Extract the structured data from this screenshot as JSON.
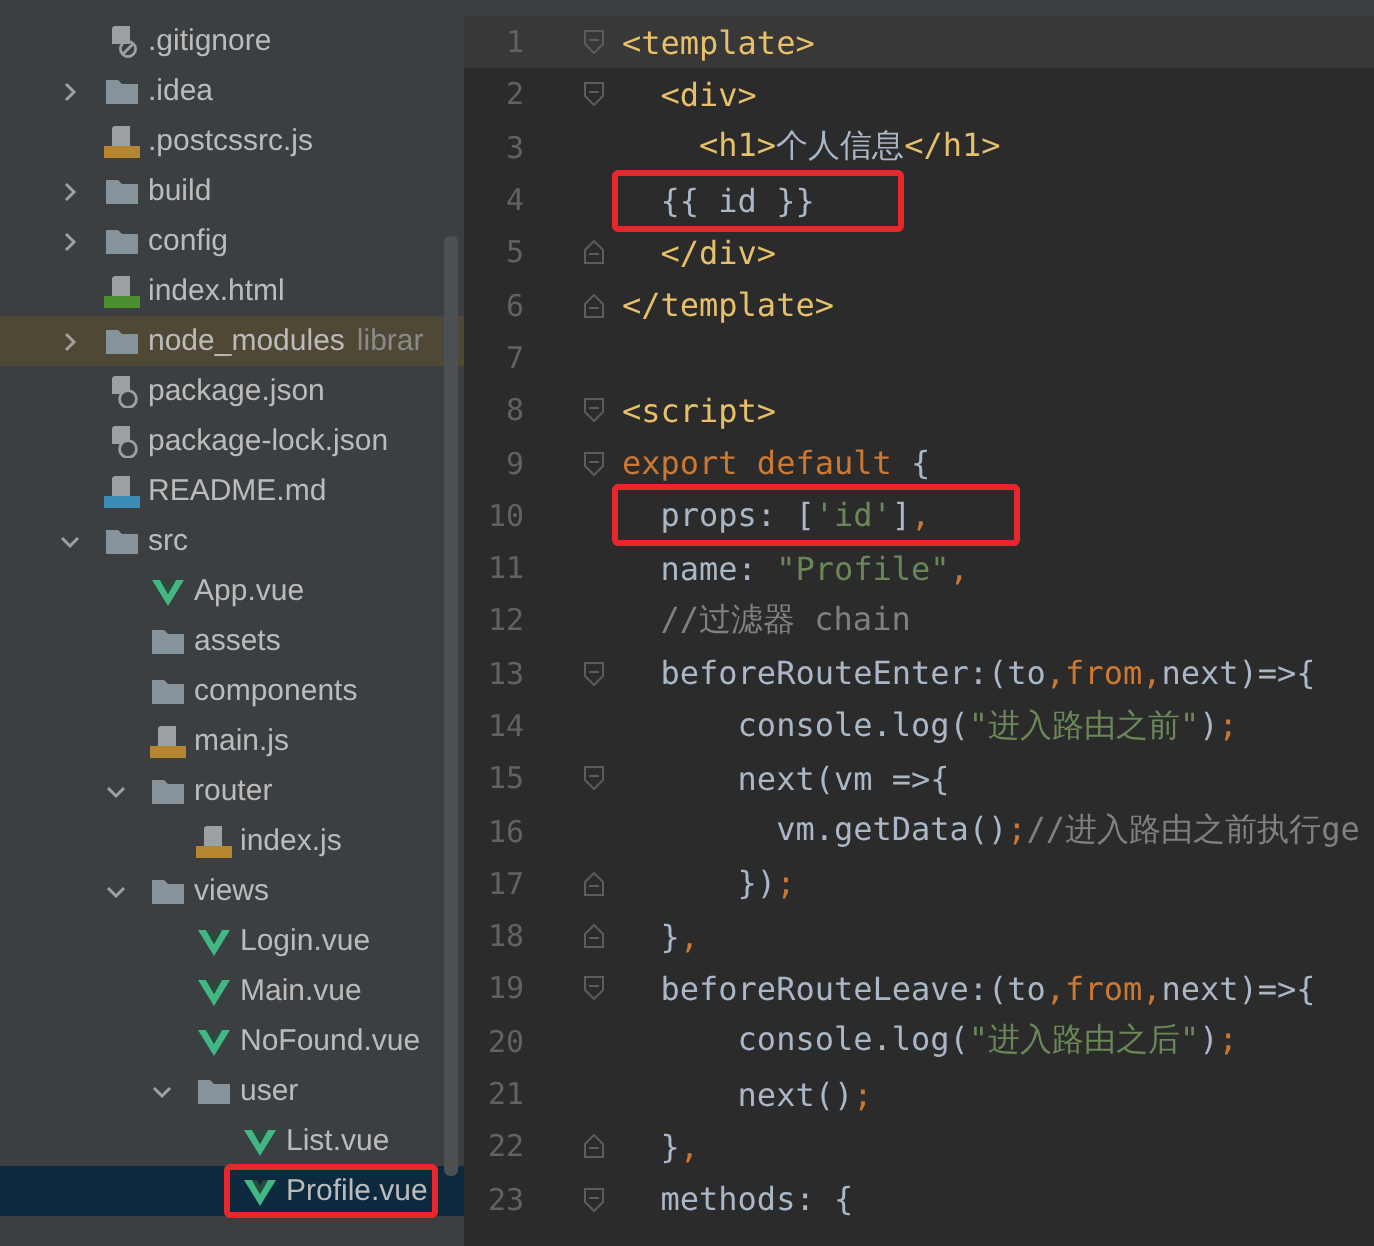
{
  "project_tree": {
    "items": [
      {
        "name": ".gitignore",
        "kind": "gitignore"
      },
      {
        "name": ".idea",
        "kind": "folder",
        "expanded": false
      },
      {
        "name": ".postcssrc.js",
        "kind": "js"
      },
      {
        "name": "build",
        "kind": "folder",
        "expanded": false
      },
      {
        "name": "config",
        "kind": "folder",
        "expanded": false
      },
      {
        "name": "index.html",
        "kind": "html"
      },
      {
        "name": "node_modules",
        "kind": "folder",
        "expanded": false,
        "suffix": "librar",
        "highlighted": true
      },
      {
        "name": "package.json",
        "kind": "json"
      },
      {
        "name": "package-lock.json",
        "kind": "json"
      },
      {
        "name": "README.md",
        "kind": "md"
      },
      {
        "name": "src",
        "kind": "folder",
        "expanded": true,
        "children": [
          {
            "name": "App.vue",
            "kind": "vue"
          },
          {
            "name": "assets",
            "kind": "folder"
          },
          {
            "name": "components",
            "kind": "folder"
          },
          {
            "name": "main.js",
            "kind": "js"
          },
          {
            "name": "router",
            "kind": "folder",
            "expanded": true,
            "children": [
              {
                "name": "index.js",
                "kind": "js"
              }
            ]
          },
          {
            "name": "views",
            "kind": "folder",
            "expanded": true,
            "children": [
              {
                "name": "Login.vue",
                "kind": "vue"
              },
              {
                "name": "Main.vue",
                "kind": "vue"
              },
              {
                "name": "NoFound.vue",
                "kind": "vue"
              },
              {
                "name": "user",
                "kind": "folder",
                "expanded": true,
                "children": [
                  {
                    "name": "List.vue",
                    "kind": "vue",
                    "selected": false
                  },
                  {
                    "name": "Profile.vue",
                    "kind": "vue",
                    "selected": true,
                    "boxed": true
                  }
                ]
              }
            ]
          }
        ]
      }
    ]
  },
  "editor": {
    "lines": [
      {
        "number": "1",
        "fold_start": true,
        "current": true,
        "tokens": [
          {
            "kind": "tag",
            "text": "<template>"
          }
        ]
      },
      {
        "number": "2",
        "fold_start": true,
        "tokens": [
          {
            "kind": "tag",
            "text": "  <div>"
          }
        ]
      },
      {
        "number": "3",
        "tokens": [
          {
            "kind": "tag",
            "text": "    <h1>"
          },
          {
            "kind": "plain",
            "text": "个人信息"
          },
          {
            "kind": "tag",
            "text": "</h1>"
          }
        ]
      },
      {
        "number": "4",
        "boxed": true,
        "tokens": [
          {
            "kind": "plain",
            "text": "  {{ id }}"
          }
        ]
      },
      {
        "number": "5",
        "fold_end": true,
        "tokens": [
          {
            "kind": "tag",
            "text": "  </div>"
          }
        ]
      },
      {
        "number": "6",
        "fold_end": true,
        "tokens": [
          {
            "kind": "tag",
            "text": "</template>"
          }
        ]
      },
      {
        "number": "7"
      },
      {
        "number": "8",
        "fold_start": true,
        "tokens": [
          {
            "kind": "tag",
            "text": "<script>"
          }
        ]
      },
      {
        "number": "9",
        "fold_start": true,
        "tokens": [
          {
            "kind": "keyword",
            "text": "export default"
          },
          {
            "kind": "plain",
            "text": " {"
          }
        ]
      },
      {
        "number": "10",
        "boxed": true,
        "tokens": [
          {
            "kind": "plain",
            "text": "  props: ["
          },
          {
            "kind": "string",
            "text": "'id'"
          },
          {
            "kind": "plain",
            "text": "]"
          },
          {
            "kind": "keyword",
            "text": ","
          }
        ]
      },
      {
        "number": "11",
        "tokens": [
          {
            "kind": "plain",
            "text": "  name: "
          },
          {
            "kind": "string",
            "text": "\"Profile\""
          },
          {
            "kind": "keyword",
            "text": ","
          }
        ]
      },
      {
        "number": "12",
        "tokens": [
          {
            "kind": "comment",
            "text": "  //过滤器 chain"
          }
        ]
      },
      {
        "number": "13",
        "fold_start": true,
        "tokens": [
          {
            "kind": "plain",
            "text": "  beforeRouteEnter:(to"
          },
          {
            "kind": "keyword",
            "text": ",from,"
          },
          {
            "kind": "plain",
            "text": "next)=>{"
          }
        ]
      },
      {
        "number": "14",
        "tokens": [
          {
            "kind": "plain",
            "text": "      console.log("
          },
          {
            "kind": "string",
            "text": "\"进入路由之前\""
          },
          {
            "kind": "plain",
            "text": ")"
          },
          {
            "kind": "keyword",
            "text": ";"
          }
        ]
      },
      {
        "number": "15",
        "fold_start": true,
        "tokens": [
          {
            "kind": "plain",
            "text": "      next(vm =>{"
          }
        ]
      },
      {
        "number": "16",
        "tokens": [
          {
            "kind": "plain",
            "text": "        vm.getData()"
          },
          {
            "kind": "keyword",
            "text": ";"
          },
          {
            "kind": "comment",
            "text": "//进入路由之前执行ge"
          }
        ]
      },
      {
        "number": "17",
        "fold_end": true,
        "tokens": [
          {
            "kind": "plain",
            "text": "      })"
          },
          {
            "kind": "keyword",
            "text": ";"
          }
        ]
      },
      {
        "number": "18",
        "fold_end": true,
        "tokens": [
          {
            "kind": "plain",
            "text": "  }"
          },
          {
            "kind": "keyword",
            "text": ","
          }
        ]
      },
      {
        "number": "19",
        "fold_start": true,
        "tokens": [
          {
            "kind": "plain",
            "text": "  beforeRouteLeave:(to"
          },
          {
            "kind": "keyword",
            "text": ",from,"
          },
          {
            "kind": "plain",
            "text": "next)=>{"
          }
        ]
      },
      {
        "number": "20",
        "tokens": [
          {
            "kind": "plain",
            "text": "      console.log("
          },
          {
            "kind": "string",
            "text": "\"进入路由之后\""
          },
          {
            "kind": "plain",
            "text": ")"
          },
          {
            "kind": "keyword",
            "text": ";"
          }
        ]
      },
      {
        "number": "21",
        "tokens": [
          {
            "kind": "plain",
            "text": "      next()"
          },
          {
            "kind": "keyword",
            "text": ";"
          }
        ]
      },
      {
        "number": "22",
        "fold_end": true,
        "tokens": [
          {
            "kind": "plain",
            "text": "  }"
          },
          {
            "kind": "keyword",
            "text": ","
          }
        ]
      },
      {
        "number": "23",
        "fold_start": true,
        "tokens": [
          {
            "kind": "plain",
            "text": "  methods: {"
          }
        ]
      }
    ]
  }
}
